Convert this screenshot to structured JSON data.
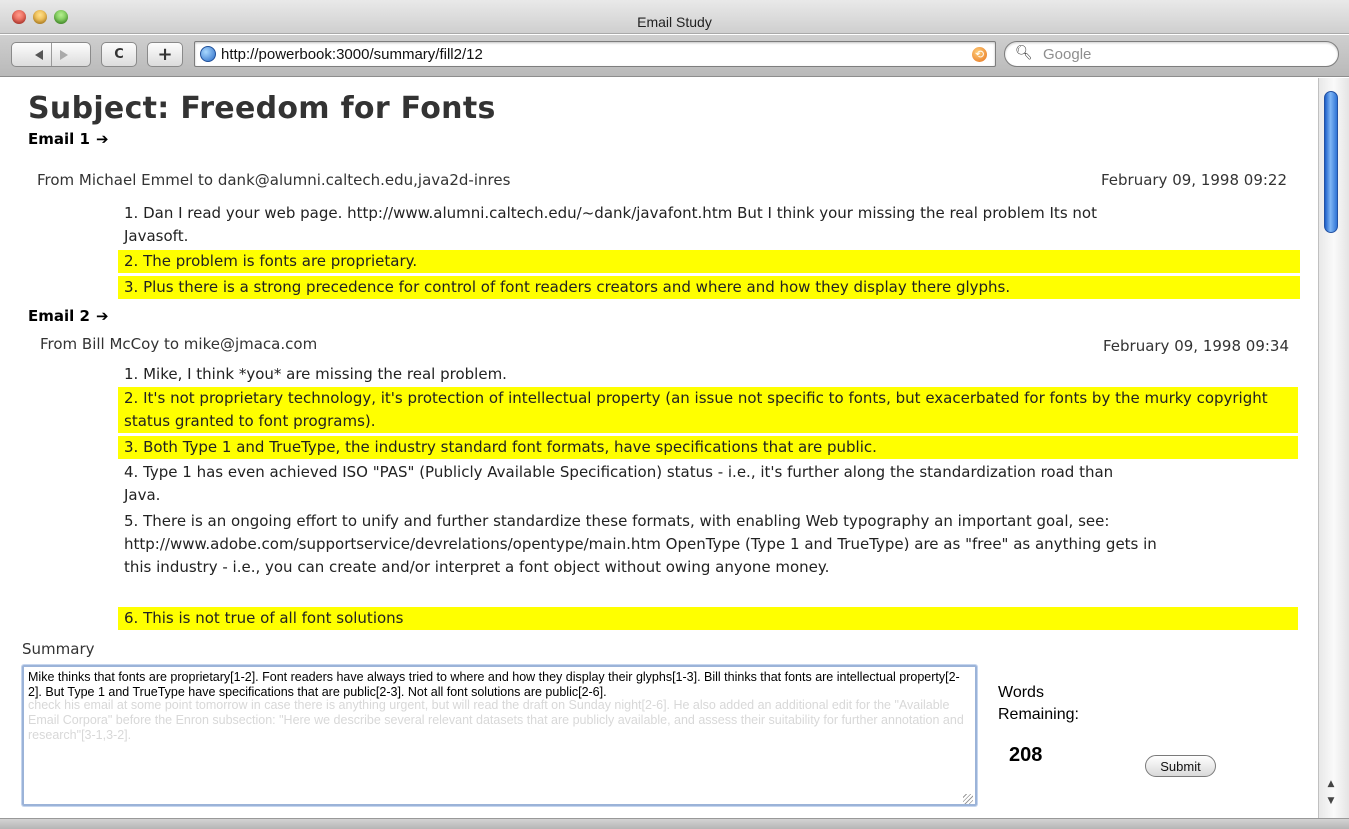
{
  "window": {
    "title": "Email Study"
  },
  "toolbar": {
    "reload_glyph": "C",
    "add_glyph": "+",
    "url": "http://powerbook:3000/summary/fill2/12",
    "search_placeholder": "Google"
  },
  "page": {
    "subject": "Subject: Freedom for Fonts",
    "emails": [
      {
        "label": "Email 1",
        "from": "From Michael Emmel to dank@alumni.caltech.edu,java2d-inres",
        "date": "February 09, 1998 09:22",
        "sentences": [
          {
            "text": "1. Dan I read your web page. http://www.alumni.caltech.edu/~dank/javafont.htm But I think your missing the real problem Its not Javasoft.",
            "highlighted": false
          },
          {
            "text": "2. The problem is fonts are proprietary.",
            "highlighted": true
          },
          {
            "text": "3. Plus there is a strong precedence for control of font readers creators and where and how they display there glyphs.",
            "highlighted": true
          }
        ]
      },
      {
        "label": "Email 2",
        "from": "From Bill McCoy to mike@jmaca.com",
        "date": "February 09, 1998 09:34",
        "sentences": [
          {
            "text": "1. Mike, I think *you* are missing the real problem.",
            "highlighted": false
          },
          {
            "text": "2. It's not proprietary technology, it's protection of intellectual property (an issue not specific to fonts, but exacerbated for fonts by the murky copyright status granted to font programs).",
            "highlighted": true
          },
          {
            "text": "3. Both Type 1 and TrueType, the industry standard font formats, have specifications that are public.",
            "highlighted": true
          },
          {
            "text": "4. Type 1 has even achieved ISO \"PAS\" (Publicly Available Specification) status - i.e., it's further along the standardization road than Java.",
            "highlighted": false
          },
          {
            "text": "5. There is an ongoing effort to unify and further standardize these formats, with enabling Web typography an important goal, see: http://www.adobe.com/supportservice/devrelations/opentype/main.htm OpenType (Type 1 and TrueType) are as \"free\" as anything gets in this industry - i.e., you can create and/or interpret a font object without owing anyone money.",
            "highlighted": false
          },
          {
            "text": "6. This is not true of all font solutions",
            "highlighted": true
          }
        ]
      }
    ],
    "summary": {
      "label": "Summary",
      "value": "Mike thinks that fonts are proprietary[1-2]. Font readers have always tried to where and how they display their glyphs[1-3]. Bill thinks that fonts are intellectual property[2-2]. But Type 1 and TrueType have specifications that are public[2-3]. Not all font solutions are public[2-6].",
      "ghost_text": "check his email at some point tomorrow in case there is anything urgent, but will read the draft on Sunday night[2-6]. He also added an additional edit for the \"Available Email Corpora\" before the Enron subsection: \"Here we describe several relevant datasets that are publicly available, and assess their suitability for further annotation and research\"[3-1,3-2]."
    },
    "words_remaining": {
      "label": "Words Remaining:",
      "count": "208"
    },
    "submit_label": "Submit"
  },
  "colors": {
    "highlight": "#ffff00",
    "scroll_thumb": "#2f74d6"
  },
  "icons": {
    "back": "arrow-left-icon",
    "forward": "arrow-right-icon",
    "reload": "reload-icon",
    "add_bookmark": "plus-icon",
    "site": "globe-icon",
    "snapback": "snapback-icon",
    "search": "magnifier-icon",
    "email_marker": "right-arrow-icon"
  }
}
